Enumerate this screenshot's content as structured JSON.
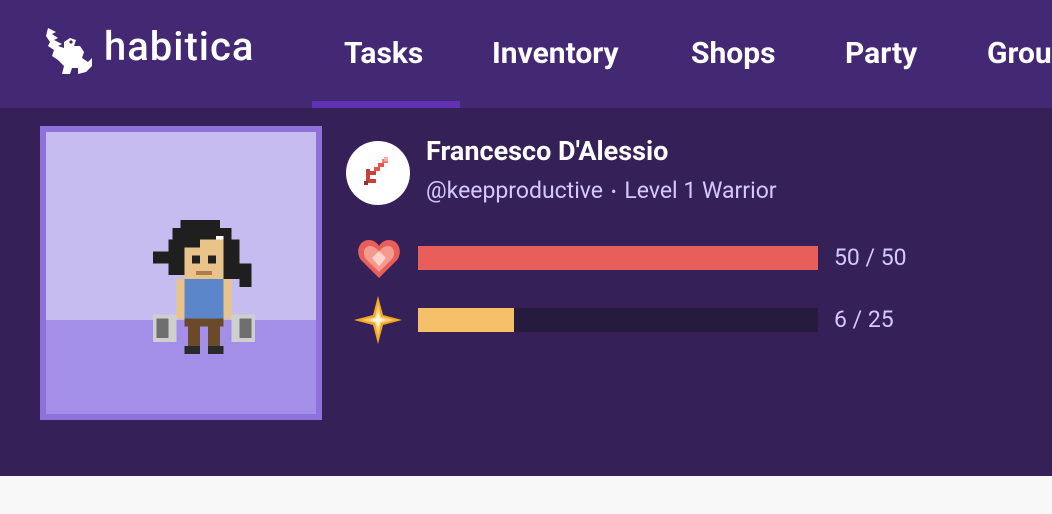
{
  "brand": {
    "name": "habitica",
    "logo_icon": "gryphon-logo-icon"
  },
  "nav": {
    "items": [
      {
        "label": "Tasks",
        "active": true
      },
      {
        "label": "Inventory",
        "active": false
      },
      {
        "label": "Shops",
        "active": false
      },
      {
        "label": "Party",
        "active": false
      },
      {
        "label": "Grou",
        "active": false
      }
    ]
  },
  "profile": {
    "name": "Francesco D'Alessio",
    "username": "@keepproductive",
    "separator": "•",
    "level_class": "Level 1 Warrior",
    "class_icon": "sword-icon"
  },
  "stats": {
    "health": {
      "icon": "heart-icon",
      "text": "50 / 50",
      "current": 50,
      "max": 50,
      "color": "#e85e5a"
    },
    "experience": {
      "icon": "star-icon",
      "text": "6 / 25",
      "current": 6,
      "max": 25,
      "color": "#f5c069"
    }
  },
  "colors": {
    "topbar": "#432874",
    "header": "#352157",
    "bar_track": "#271b3d",
    "avatar_sky": "#c6bcf0",
    "avatar_ground": "#a38fe8",
    "avatar_border": "#8f71db",
    "secondary_text": "#d5c8ff"
  }
}
